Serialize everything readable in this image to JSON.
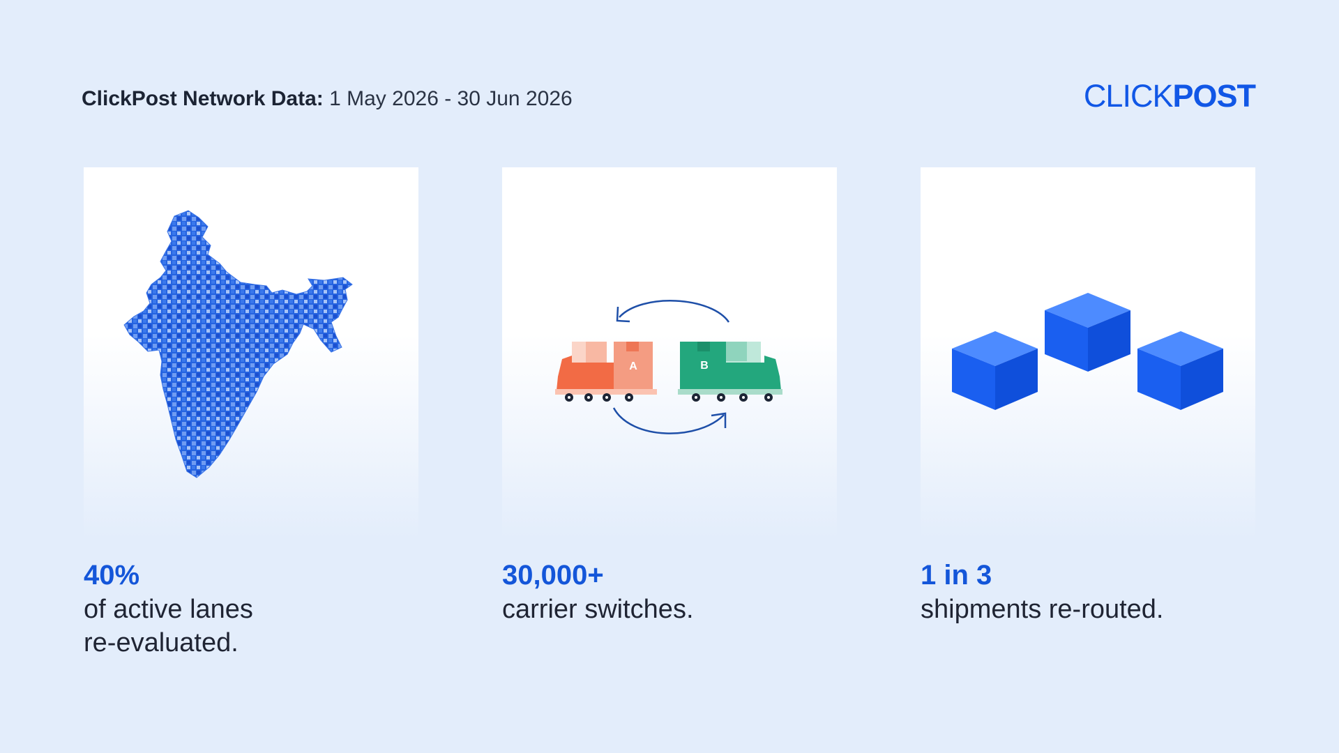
{
  "header": {
    "label": "ClickPost Network Data:",
    "date_range": "1 May 2026 - 30 Jun 2026"
  },
  "logo": {
    "part1": "CLICK",
    "part2": "POST"
  },
  "colors": {
    "brand": "#1157e6",
    "stat": "#1456d9",
    "truck_a": "#f26b45",
    "truck_b": "#23a77d",
    "cube": "#1a5ff0",
    "background": "#e3edfb"
  },
  "stats": [
    {
      "value": "40%",
      "description": "of active lanes\nre-evaluated.",
      "icon": "india-map-icon"
    },
    {
      "value": "30,000+",
      "description": "carrier switches.",
      "icon": "carrier-switch-icon"
    },
    {
      "value": "1 in 3",
      "description": "shipments re-routed.",
      "icon": "cubes-icon"
    }
  ],
  "trucks": {
    "a_label": "A",
    "b_label": "B"
  }
}
